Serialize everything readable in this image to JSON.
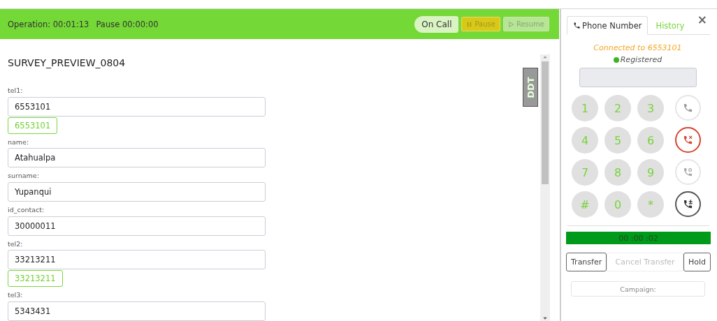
{
  "header": {
    "operation": "Operation: 00:01:13",
    "pause": "Pause 00:00:00",
    "status": "On Call",
    "buttons": [
      {
        "label": "Pause",
        "kind": "pause",
        "disabled": true
      },
      {
        "label": "Resume",
        "kind": "resume",
        "disabled": true
      }
    ]
  },
  "survey": {
    "title": "SURVEY_PREVIEW_0804",
    "logo": "DDT",
    "fields": [
      {
        "label": "tel1:",
        "value": "6553101",
        "chip": "6553101"
      },
      {
        "label": "name:",
        "value": "Atahualpa"
      },
      {
        "label": "surname:",
        "value": "Yupanqui"
      },
      {
        "label": "id_contact:",
        "value": "30000011"
      },
      {
        "label": "tel2:",
        "value": "33213211",
        "chip": "33213211"
      },
      {
        "label": "tel3:",
        "value": "5343431"
      }
    ]
  },
  "phone": {
    "tabs": [
      {
        "label": "Phone Number",
        "selected": true
      },
      {
        "label": "History",
        "selected": false
      }
    ],
    "close": "×",
    "connection": "Connected to 6553101",
    "registration": "Registered",
    "registered": true,
    "keys": [
      "1",
      "2",
      "3",
      "4",
      "5",
      "6",
      "7",
      "8",
      "9",
      "#",
      "0",
      "*"
    ],
    "actions": [
      {
        "kind": "call"
      },
      {
        "kind": "hangup"
      },
      {
        "kind": "transfer"
      },
      {
        "kind": "conference"
      }
    ],
    "timer": "00 :00 :02",
    "transfer_buttons": [
      {
        "label": "Transfer",
        "disabled": false
      },
      {
        "label": "Cancel Transfer",
        "disabled": true
      },
      {
        "label": "Hold",
        "disabled": false
      }
    ],
    "campaign": {
      "placeholder": "Campaign:"
    }
  }
}
